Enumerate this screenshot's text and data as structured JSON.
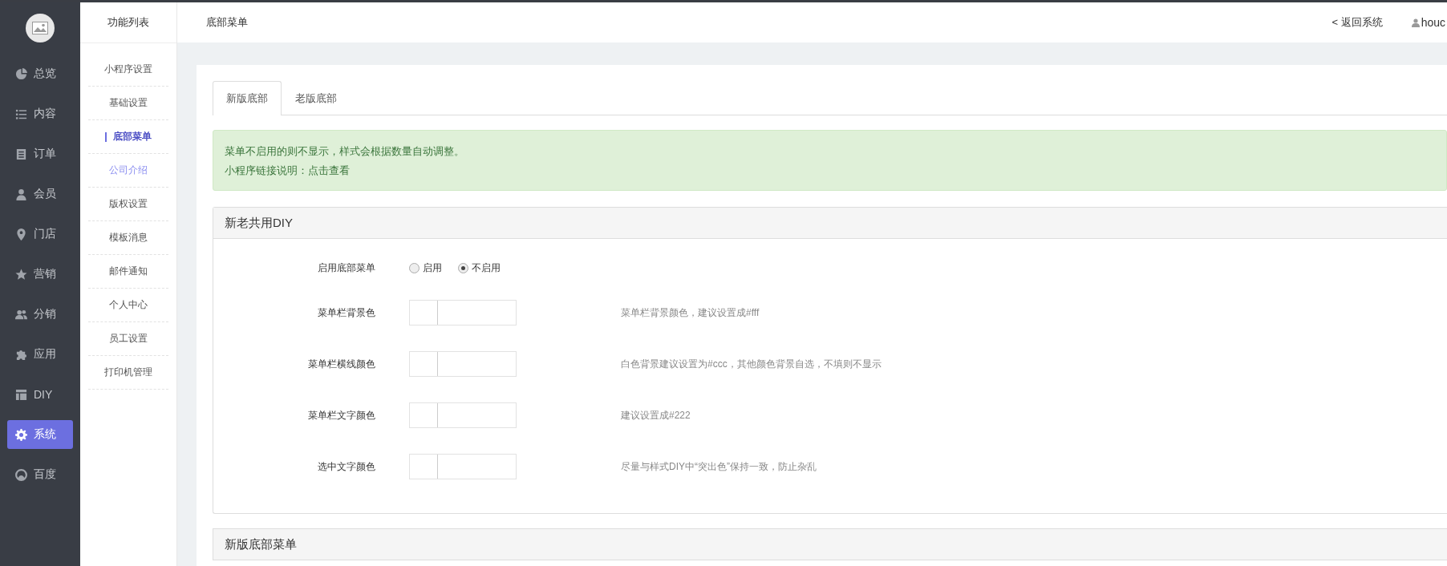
{
  "nav": [
    {
      "label": "总览",
      "selected": false
    },
    {
      "label": "内容",
      "selected": false
    },
    {
      "label": "订单",
      "selected": false
    },
    {
      "label": "会员",
      "selected": false
    },
    {
      "label": "门店",
      "selected": false
    },
    {
      "label": "营销",
      "selected": false
    },
    {
      "label": "分销",
      "selected": false
    },
    {
      "label": "应用",
      "selected": false
    },
    {
      "label": "DIY",
      "selected": false
    },
    {
      "label": "系统",
      "selected": true
    },
    {
      "label": "百度",
      "selected": false
    }
  ],
  "submenu": {
    "title": "功能列表",
    "items": [
      {
        "label": "小程序设置",
        "selected": false,
        "hover": false
      },
      {
        "label": "基础设置",
        "selected": false,
        "hover": false
      },
      {
        "label": "底部菜单",
        "selected": true,
        "hover": false
      },
      {
        "label": "公司介绍",
        "selected": false,
        "hover": true
      },
      {
        "label": "版权设置",
        "selected": false,
        "hover": false
      },
      {
        "label": "模板消息",
        "selected": false,
        "hover": false
      },
      {
        "label": "邮件通知",
        "selected": false,
        "hover": false
      },
      {
        "label": "个人中心",
        "selected": false,
        "hover": false
      },
      {
        "label": "员工设置",
        "selected": false,
        "hover": false
      },
      {
        "label": "打印机管理",
        "selected": false,
        "hover": false
      }
    ]
  },
  "header": {
    "title": "底部菜单",
    "back": "< 返回系统",
    "user": "houc"
  },
  "tabs": [
    {
      "label": "新版底部",
      "selected": true
    },
    {
      "label": "老版底部",
      "selected": false
    }
  ],
  "alert": {
    "line1": "菜单不启用的则不显示，样式会根据数量自动调整。",
    "line2": "小程序链接说明：",
    "link": "点击查看"
  },
  "panel": {
    "title": "新老共用DIY",
    "rows": [
      {
        "kind": "radio",
        "label": "启用底部菜单",
        "options": [
          {
            "label": "启用",
            "selected": false
          },
          {
            "label": "不启用",
            "selected": true
          }
        ]
      },
      {
        "kind": "color",
        "label": "菜单栏背景色",
        "help": "菜单栏背景颜色，建议设置成#fff"
      },
      {
        "kind": "color",
        "label": "菜单栏横线颜色",
        "help": "白色背景建议设置为#ccc，其他颜色背景自选，不填则不显示"
      },
      {
        "kind": "color",
        "label": "菜单栏文字颜色",
        "help": "建议设置成#222"
      },
      {
        "kind": "color",
        "label": "选中文字颜色",
        "help": "尽量与样式DIY中“突出色”保持一致，防止杂乱"
      }
    ]
  },
  "panel2": {
    "title": "新版底部菜单"
  }
}
